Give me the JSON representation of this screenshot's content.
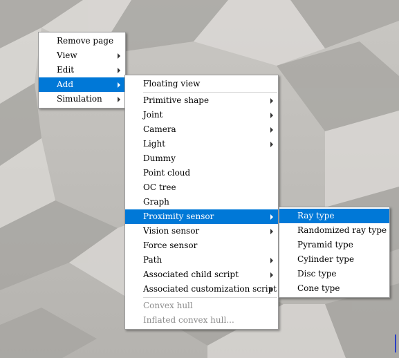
{
  "menu_main": [
    {
      "label": "Remove page",
      "submenu": false
    },
    {
      "label": "View",
      "submenu": true
    },
    {
      "label": "Edit",
      "submenu": true
    },
    {
      "label": "Add",
      "submenu": true,
      "selected": true
    },
    {
      "label": "Simulation",
      "submenu": true
    }
  ],
  "menu_add": {
    "items_top": [
      {
        "label": "Floating view",
        "submenu": false
      }
    ],
    "items_mid": [
      {
        "label": "Primitive shape",
        "submenu": true
      },
      {
        "label": "Joint",
        "submenu": true
      },
      {
        "label": "Camera",
        "submenu": true
      },
      {
        "label": "Light",
        "submenu": true
      },
      {
        "label": "Dummy",
        "submenu": false
      },
      {
        "label": "Point cloud",
        "submenu": false
      },
      {
        "label": "OC tree",
        "submenu": false
      },
      {
        "label": "Graph",
        "submenu": false
      },
      {
        "label": "Proximity sensor",
        "submenu": true,
        "selected": true
      },
      {
        "label": "Vision sensor",
        "submenu": true
      },
      {
        "label": "Force sensor",
        "submenu": false
      },
      {
        "label": "Path",
        "submenu": true
      },
      {
        "label": "Associated child script",
        "submenu": true
      },
      {
        "label": "Associated customization script",
        "submenu": true
      }
    ],
    "items_bottom": [
      {
        "label": "Convex hull",
        "disabled": true
      },
      {
        "label": "Inflated convex hull...",
        "disabled": true
      }
    ]
  },
  "menu_proximity": [
    {
      "label": "Ray type",
      "selected": true
    },
    {
      "label": "Randomized ray type"
    },
    {
      "label": "Pyramid type"
    },
    {
      "label": "Cylinder type"
    },
    {
      "label": "Disc type"
    },
    {
      "label": "Cone type"
    }
  ],
  "colors": {
    "selection": "#0078d7",
    "floor_light": "#d4d2ce",
    "floor_dark": "#a9a7a3"
  }
}
